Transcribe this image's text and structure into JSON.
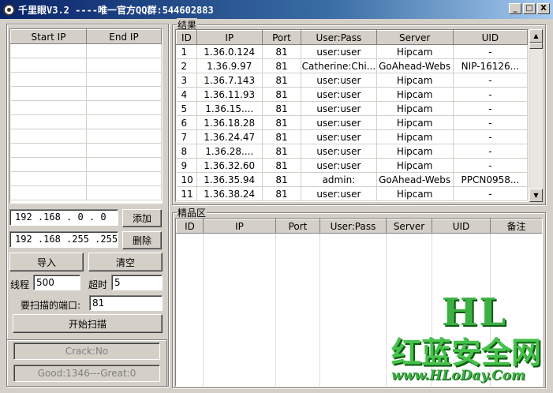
{
  "window": {
    "title": "千里眼V3.2 ----唯一官方QQ群:544602883",
    "buttons": {
      "minimize": "_",
      "maximize": "□",
      "close": "X"
    }
  },
  "ip_list": {
    "columns": [
      "Start IP",
      "End IP"
    ],
    "start_ip": "192 .168 . 0  . 0",
    "end_ip": "192 .168 .255 .255",
    "add_label": "添加",
    "delete_label": "删除",
    "import_label": "导入",
    "clear_label": "清空"
  },
  "settings": {
    "threads_label": "线程",
    "threads_value": "500",
    "timeout_label": "超时",
    "timeout_value": "5",
    "port_label": "要扫描的端口:",
    "port_value": "81",
    "start_label": "开始扫描"
  },
  "status": {
    "crack": "Crack:No",
    "good": "Good:1346---Great:0"
  },
  "results": {
    "title": "结果",
    "columns": [
      "ID",
      "IP",
      "Port",
      "User:Pass",
      "Server",
      "UID"
    ],
    "rows": [
      [
        "1",
        "1.36.0.124",
        "81",
        "user:user",
        "Hipcam",
        "-"
      ],
      [
        "2",
        "1.36.9.97",
        "81",
        "Catherine:Chi...",
        "GoAhead-Webs",
        "NIP-16126..."
      ],
      [
        "3",
        "1.36.7.143",
        "81",
        "user:user",
        "Hipcam",
        "-"
      ],
      [
        "4",
        "1.36.11.93",
        "81",
        "user:user",
        "Hipcam",
        "-"
      ],
      [
        "5",
        "1.36.15....",
        "81",
        "user:user",
        "Hipcam",
        "-"
      ],
      [
        "6",
        "1.36.18.28",
        "81",
        "user:user",
        "Hipcam",
        "-"
      ],
      [
        "7",
        "1.36.24.47",
        "81",
        "user:user",
        "Hipcam",
        "-"
      ],
      [
        "8",
        "1.36.28....",
        "81",
        "user:user",
        "Hipcam",
        "-"
      ],
      [
        "9",
        "1.36.32.60",
        "81",
        "user:user",
        "Hipcam",
        "-"
      ],
      [
        "10",
        "1.36.35.94",
        "81",
        "admin:",
        "GoAhead-Webs",
        "PPCN0958..."
      ],
      [
        "11",
        "1.36.38.24",
        "81",
        "user:user",
        "Hipcam",
        "-"
      ]
    ]
  },
  "fine": {
    "title": "精品区",
    "columns": [
      "ID",
      "IP",
      "Port",
      "User:Pass",
      "Server",
      "UID",
      "备注"
    ]
  },
  "watermark": {
    "brand": "HL",
    "name": "红蓝安全网",
    "url": "www.HLoDay.Com"
  }
}
